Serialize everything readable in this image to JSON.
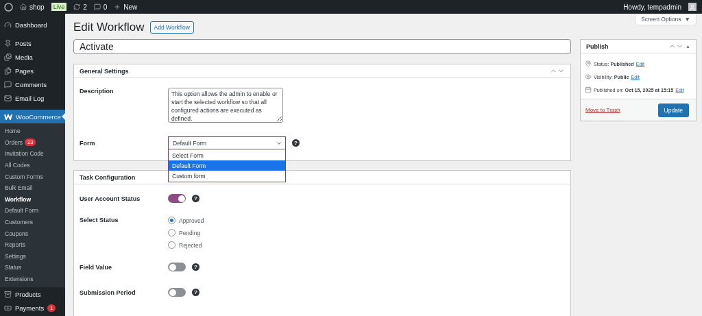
{
  "admin_bar": {
    "site": "shop",
    "live_badge": "Live",
    "updates": "2",
    "comments": "0",
    "new": "New",
    "greeting": "Howdy, tempadmin"
  },
  "screen_options": {
    "label": "Screen Options",
    "caret": "▼"
  },
  "sidebar": {
    "items": [
      {
        "label": "Dashboard",
        "selected": false
      },
      {
        "label": "Posts",
        "selected": false
      },
      {
        "label": "Media",
        "selected": false
      },
      {
        "label": "Pages",
        "selected": false
      },
      {
        "label": "Comments",
        "selected": false
      },
      {
        "label": "Email Log",
        "selected": false
      },
      {
        "label": "WooCommerce",
        "selected": true,
        "children": [
          {
            "label": "Home",
            "selected": false
          },
          {
            "label": "Orders",
            "badge": "23",
            "selected": false
          },
          {
            "label": "Invitation Code",
            "selected": false
          },
          {
            "label": "All Codes",
            "selected": false
          },
          {
            "label": "Custom Forms",
            "selected": false
          },
          {
            "label": "Bulk Email",
            "selected": false
          },
          {
            "label": "Workflow",
            "selected": true
          },
          {
            "label": "Default Form",
            "selected": false
          },
          {
            "label": "Customers",
            "selected": false
          },
          {
            "label": "Coupons",
            "selected": false
          },
          {
            "label": "Reports",
            "selected": false
          },
          {
            "label": "Settings",
            "selected": false
          },
          {
            "label": "Status",
            "selected": false
          },
          {
            "label": "Extensions",
            "selected": false
          }
        ]
      },
      {
        "label": "Products",
        "selected": false
      },
      {
        "label": "Payments",
        "badge": "1",
        "selected": false
      }
    ]
  },
  "page": {
    "title": "Edit Workflow",
    "add_button": "Add Workflow",
    "name_value": "Activate"
  },
  "general_settings": {
    "title": "General Settings",
    "description_label": "Description",
    "description_value": "This option allows the admin to enable or start the selected workflow so that all configured actions are executed as defined.",
    "form_label": "Form",
    "form_value": "Default Form",
    "help": "?",
    "dropdown": {
      "open": true,
      "options": [
        {
          "label": "Select Form",
          "selected": false
        },
        {
          "label": "Default Form",
          "selected": true
        },
        {
          "label": "Custom form",
          "selected": false
        }
      ]
    }
  },
  "task_configuration": {
    "title": "Task Configuration",
    "rows": [
      {
        "kind": "toggle",
        "label": "User Account Status",
        "on": true,
        "help": "?"
      },
      {
        "kind": "radio",
        "label": "Select Status",
        "options": [
          {
            "label": "Approved",
            "selected": true
          },
          {
            "label": "Pending",
            "selected": false
          },
          {
            "label": "Rejected",
            "selected": false
          }
        ]
      },
      {
        "kind": "toggle",
        "label": "Field Value",
        "on": false,
        "help": "?"
      },
      {
        "kind": "toggle",
        "label": "Submission Period",
        "on": false,
        "help": "?"
      }
    ]
  },
  "publish": {
    "title": "Publish",
    "toggle_arrow": "▲",
    "rows": [
      {
        "text": "Status: **Published**",
        "link": "Edit"
      },
      {
        "text": "Visibility: **Public**",
        "link": "Edit"
      },
      {
        "text": "Published on: **Oct 15, 2025 at 15:15**",
        "link": "Edit"
      }
    ],
    "trash": "Move to Trash",
    "update": "Update"
  }
}
